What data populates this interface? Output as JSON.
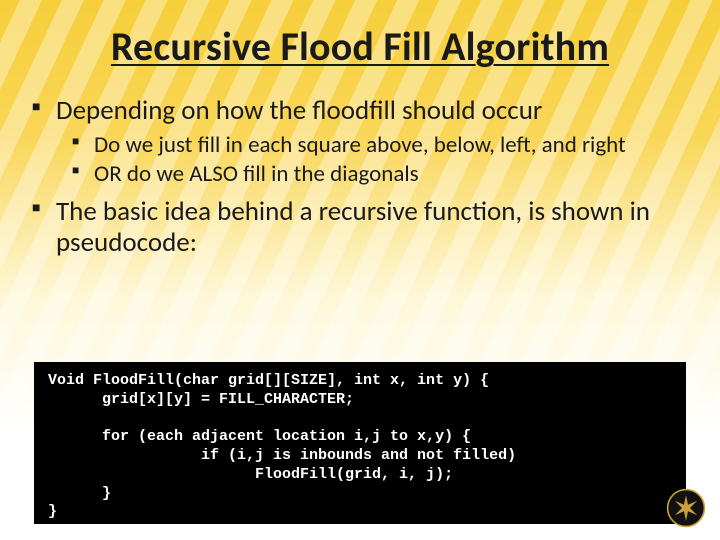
{
  "title": "Recursive Flood Fill Algorithm",
  "bullets": {
    "b1": "Depending on how the floodfill should occur",
    "b1_sub": {
      "s1": "Do we just fill in each square above, below, left, and right",
      "s2": "OR do we ALSO fill in the diagonals"
    },
    "b2": "The basic idea behind a recursive function, is shown in pseudocode:"
  },
  "code": "Void FloodFill(char grid[][SIZE], int x, int y) {\n      grid[x][y] = FILL_CHARACTER;\n\n      for (each adjacent location i,j to x,y) {\n                 if (i,j is inbounds and not filled)\n                       FloodFill(grid, i, j);\n      }\n}",
  "logo_alt": "UCF Pegasus seal"
}
